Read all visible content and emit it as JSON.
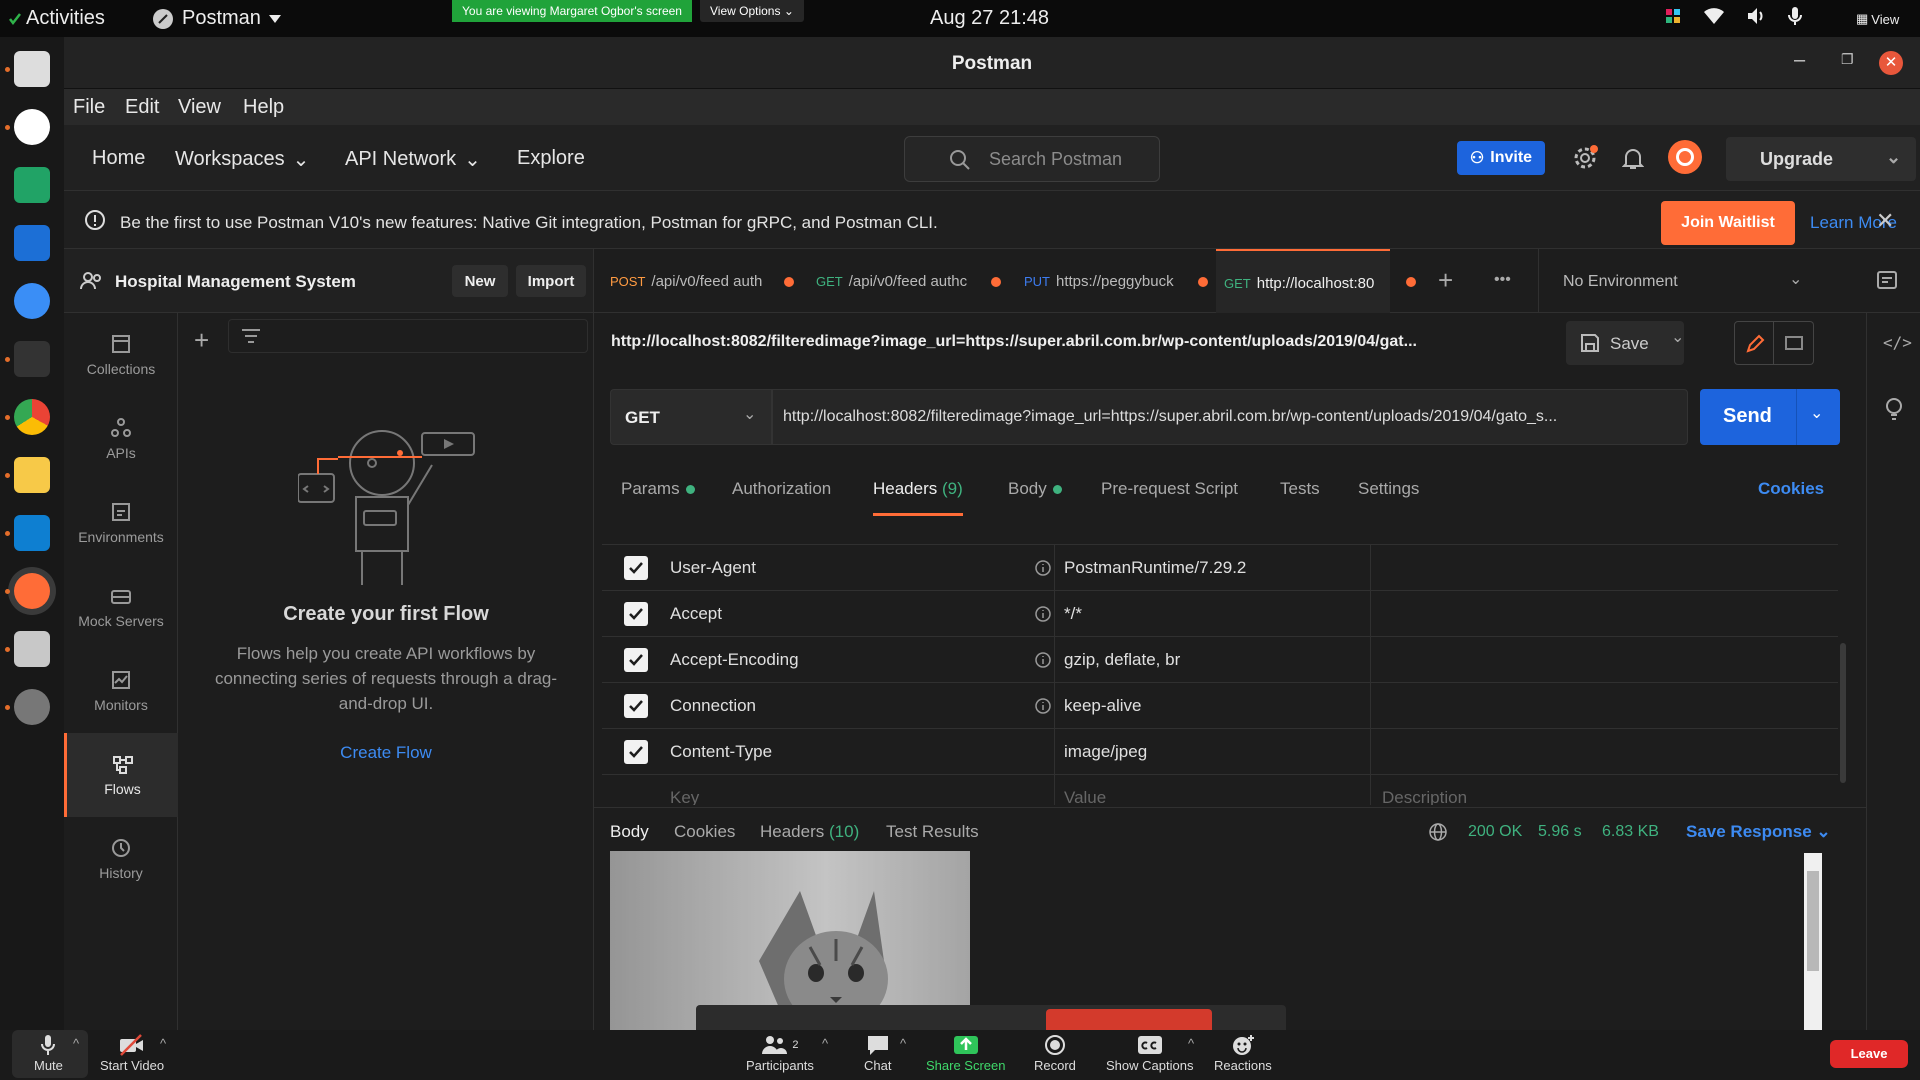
{
  "system": {
    "activities": "Activities",
    "app_name": "Postman",
    "share_banner": "You are viewing Margaret Ogbor's screen",
    "view_options": "View Options",
    "clock": "Aug 27  21:48",
    "view": "View"
  },
  "window": {
    "title": "Postman"
  },
  "menu": [
    "File",
    "Edit",
    "View",
    "Help"
  ],
  "nav": {
    "home": "Home",
    "workspaces": "Workspaces",
    "api_network": "API Network",
    "explore": "Explore",
    "search_placeholder": "Search Postman",
    "invite": "Invite",
    "upgrade": "Upgrade"
  },
  "notice": {
    "text": "Be the first to use Postman V10's new features: Native Git integration, Postman for gRPC, and Postman CLI.",
    "join": "Join Waitlist",
    "learn": "Learn More"
  },
  "workspace": {
    "name": "Hospital Management System",
    "new": "New",
    "import": "Import"
  },
  "sidebar": {
    "items": [
      {
        "label": "Collections",
        "icon": "collections-icon"
      },
      {
        "label": "APIs",
        "icon": "apis-icon"
      },
      {
        "label": "Environments",
        "icon": "environments-icon"
      },
      {
        "label": "Mock Servers",
        "icon": "mock-servers-icon"
      },
      {
        "label": "Monitors",
        "icon": "monitors-icon"
      },
      {
        "label": "Flows",
        "icon": "flows-icon"
      },
      {
        "label": "History",
        "icon": "history-icon"
      }
    ]
  },
  "flows": {
    "title": "Create your first Flow",
    "desc": "Flows help you create API workflows by connecting series of requests through a drag-and-drop UI.",
    "cta": "Create Flow"
  },
  "tabs": [
    {
      "method": "POST",
      "url": "/api/v0/feed auth",
      "color": "#ff9b42"
    },
    {
      "method": "GET",
      "url": "/api/v0/feed authc",
      "color": "#3fb27f"
    },
    {
      "method": "PUT",
      "url": "https://peggybuck",
      "color": "#3d7cf0"
    },
    {
      "method": "GET",
      "url": "http://localhost:80",
      "color": "#3fb27f"
    }
  ],
  "environment": "No Environment",
  "request": {
    "name": "http://localhost:8082/filteredimage?image_url=https://super.abril.com.br/wp-content/uploads/2019/04/gat...",
    "save": "Save",
    "method": "GET",
    "url": "http://localhost:8082/filteredimage?image_url=https://super.abril.com.br/wp-content/uploads/2019/04/gato_s...",
    "send": "Send"
  },
  "req_tabs": {
    "params": "Params",
    "auth": "Authorization",
    "headers": "Headers",
    "headers_count": "(9)",
    "body": "Body",
    "prerequest": "Pre-request Script",
    "tests": "Tests",
    "settings": "Settings",
    "cookies": "Cookies"
  },
  "headers": [
    {
      "key": "User-Agent",
      "value": "PostmanRuntime/7.29.2",
      "info": true
    },
    {
      "key": "Accept",
      "value": "*/*",
      "info": true
    },
    {
      "key": "Accept-Encoding",
      "value": "gzip, deflate, br",
      "info": true
    },
    {
      "key": "Connection",
      "value": "keep-alive",
      "info": true
    },
    {
      "key": "Content-Type",
      "value": "image/jpeg",
      "info": false
    }
  ],
  "header_placeholders": {
    "key": "Key",
    "value": "Value",
    "desc": "Description"
  },
  "response": {
    "body": "Body",
    "cookies": "Cookies",
    "headers": "Headers",
    "headers_count": "(10)",
    "tests": "Test Results",
    "status": "200 OK",
    "time": "5.96 s",
    "size": "6.83 KB",
    "save": "Save Response"
  },
  "zoom": {
    "mute": "Mute",
    "video": "Start Video",
    "participants": "Participants",
    "participants_count": "2",
    "chat": "Chat",
    "share": "Share Screen",
    "record": "Record",
    "captions": "Show Captions",
    "reactions": "Reactions",
    "leave": "Leave"
  },
  "colors": {
    "accent": "#ff6c37",
    "send": "#1d64dd",
    "success": "#3fb27f"
  }
}
